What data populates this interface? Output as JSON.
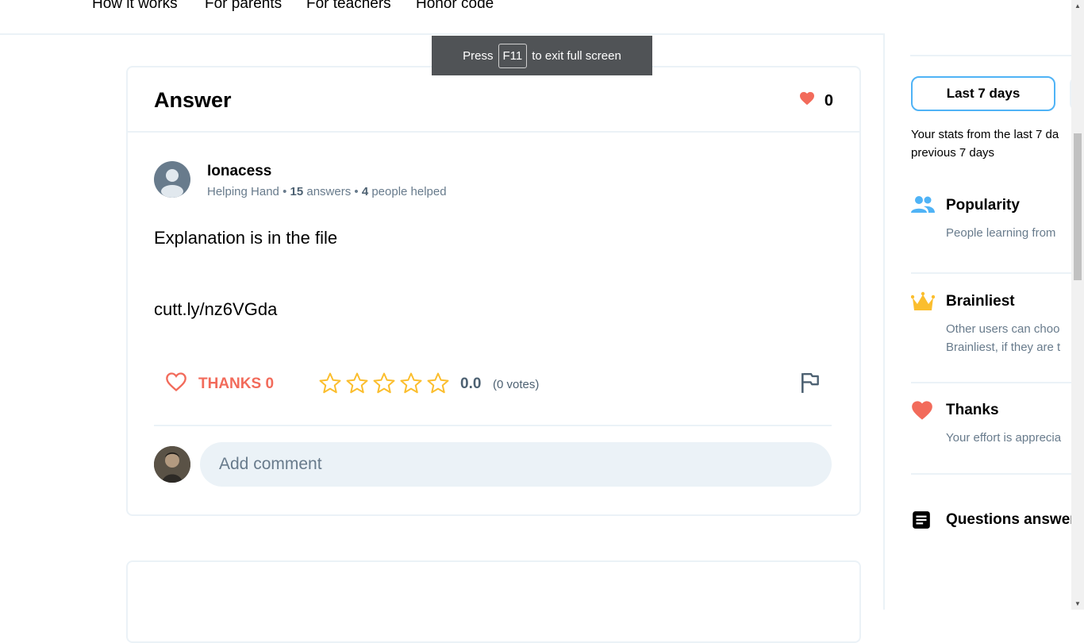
{
  "nav": {
    "links": [
      "How it works",
      "For parents",
      "For teachers",
      "Honor code"
    ]
  },
  "toast": {
    "press": "Press",
    "key": "F11",
    "suffix": "to exit full screen"
  },
  "answer": {
    "title": "Answer",
    "likes": "0",
    "author": {
      "name": "Ionacess",
      "rank": "Helping Hand",
      "answers_count": "15",
      "answers_label": "answers",
      "helped_count": "4",
      "helped_label": "people helped"
    },
    "body": "Explanation is in the file",
    "link": "cutt.ly/nz6VGda",
    "thanks_label": "THANKS 0",
    "rating": "0.0",
    "votes": "(0 votes)",
    "stars": 5,
    "comment_placeholder": "Add comment"
  },
  "sidebar": {
    "period_button": "Last 7 days",
    "stats_description": "Your stats from the last 7 da previous 7 days",
    "stats_line1": "Your stats from the last 7 da",
    "stats_line2": "previous 7 days",
    "items": [
      {
        "title": "Popularity",
        "desc1": "People learning from",
        "desc2": "",
        "icon": "people-icon"
      },
      {
        "title": "Brainliest",
        "desc1": "Other users can choo",
        "desc2": "Brainliest, if they are t",
        "icon": "crown-icon"
      },
      {
        "title": "Thanks",
        "desc1": "Your effort is apprecia",
        "desc2": "",
        "icon": "heart-icon"
      },
      {
        "title": "Questions answer",
        "desc1": "",
        "desc2": "",
        "icon": "document-icon"
      }
    ]
  },
  "colors": {
    "accent_red": "#f26b5b",
    "accent_blue": "#4fb3f6",
    "star_yellow": "#fbbe2e",
    "muted_text": "#687b8c",
    "border": "#ebf2f7"
  }
}
